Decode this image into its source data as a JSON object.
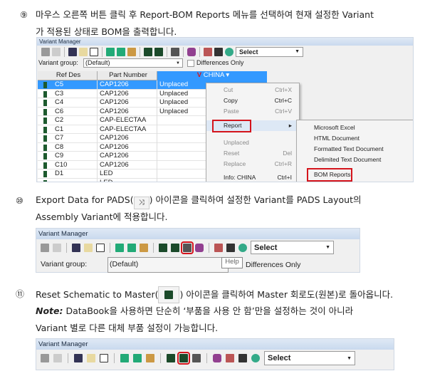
{
  "step9": {
    "marker": "⑨",
    "line1": "마우스 오른쪽 버튼 클릭 후 Report-BOM Reports 메뉴를 선택하여 현재 설정한 Variant",
    "line2": "가 적용된 상태로 BOM을 출력합니다."
  },
  "step10": {
    "marker": "⑩",
    "line1a": "Export Data for PADS(",
    "line1b": ") 아이콘을 클릭하여 설정한 Variant를 PADS Layout의",
    "line2": "Assembly Variant에 적용합니다."
  },
  "step11": {
    "marker": "⑪",
    "line1a": "Reset Schematic to Master(",
    "line1b": ") 아이콘을 클릭하여 Master 회로도(원본)로 돌아옵니다.",
    "note_label": "Note:",
    "note_text": " DataBook을 사용하면 단순히 ‘부품을 사용 안 함’만을 설정하는 것이 아니라",
    "line3": "Variant 별로 다른 대체 부품 설정이 가능합니다."
  },
  "window": {
    "title": "Variant Manager",
    "select_value": "Select",
    "variant_group_label": "Variant group:",
    "variant_group_value": "(Default)",
    "differences_only": "Differences Only",
    "help_tooltip": "Help"
  },
  "table": {
    "headers": [
      "Ref Des",
      "Part Number",
      "CHINA"
    ],
    "rows": [
      [
        "C5",
        "CAP1206",
        "Unplaced"
      ],
      [
        "C3",
        "CAP1206",
        "Unplaced"
      ],
      [
        "C4",
        "CAP1206",
        "Unplaced"
      ],
      [
        "C6",
        "CAP1206",
        "Unplaced"
      ],
      [
        "C2",
        "CAP-ELECTAA",
        ""
      ],
      [
        "C1",
        "CAP-ELECTAA",
        ""
      ],
      [
        "C7",
        "CAP1206",
        ""
      ],
      [
        "C8",
        "CAP1206",
        ""
      ],
      [
        "C9",
        "CAP1206",
        ""
      ],
      [
        "C10",
        "CAP1206",
        ""
      ],
      [
        "D1",
        "LED",
        ""
      ],
      [
        "",
        "LED",
        ""
      ]
    ]
  },
  "context_menu": [
    {
      "label": "Cut",
      "shortcut": "Ctrl+X",
      "disabled": true
    },
    {
      "label": "Copy",
      "shortcut": "Ctrl+C"
    },
    {
      "label": "Paste",
      "shortcut": "Ctrl+V",
      "disabled": true
    },
    {
      "label": "Report",
      "shortcut": "▸"
    },
    {
      "label": "Unplaced",
      "shortcut": "",
      "disabled": true
    },
    {
      "label": "Reset",
      "shortcut": "Del",
      "disabled": true
    },
    {
      "label": "Replace",
      "shortcut": "Ctrl+R",
      "disabled": true
    },
    {
      "label": "Info: CHINA",
      "shortcut": "Ctrl+I"
    }
  ],
  "submenu": [
    "Microsoft Excel",
    "HTML Document",
    "Formatted Text Document",
    "Delimited Text Document",
    "BOM Reports"
  ],
  "colors": {
    "highlight": "#d4141c",
    "selection": "#3399ff"
  }
}
